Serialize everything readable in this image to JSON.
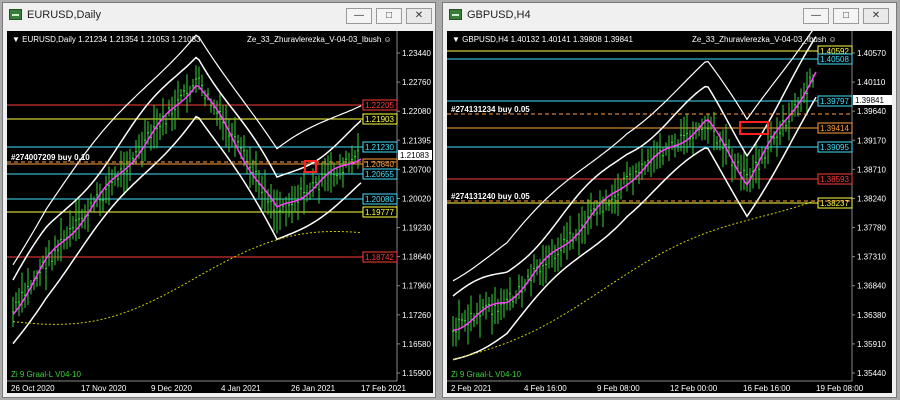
{
  "windows": [
    {
      "id": "left",
      "title": "EURUSD,Daily",
      "header": "▼ EURUSD,Daily  1.21234 1.21354 1.21053 1.21083",
      "indicator": "Ze_33_Zhuravlerezka_V-04-03_Ibush",
      "order_label": "#274007209 buy 0.10",
      "footer_label": "Zi 9 Graal-L V04-10",
      "current_price": "1.21083",
      "price_axis": [
        "1.23440",
        "1.22760",
        "1.22080",
        "1.21395",
        "1.20700",
        "1.20020",
        "1.19230",
        "1.18640",
        "1.17960",
        "1.17260",
        "1.16580",
        "1.15900"
      ],
      "time_axis": [
        "26 Oct 2020",
        "17 Nov 2020",
        "9 Dec 2020",
        "4 Jan 2021",
        "26 Jan 2021",
        "17 Feb 2021"
      ],
      "levels": [
        {
          "label": "1.22205",
          "color": "#ff3b3b"
        },
        {
          "label": "1.21903",
          "color": "#ffff40"
        },
        {
          "label": "1.21230",
          "color": "#40e0ff"
        },
        {
          "label": "1.20840",
          "color": "#ffa040"
        },
        {
          "label": "1.20655",
          "color": "#40e0ff"
        },
        {
          "label": "1.20080",
          "color": "#40e0ff"
        },
        {
          "label": "1.19777",
          "color": "#ffff40"
        },
        {
          "label": "1.18742",
          "color": "#ff3b3b"
        }
      ]
    },
    {
      "id": "right",
      "title": "GBPUSD,H4",
      "header": "▼ GBPUSD,H4  1.40132 1.40141 1.39808 1.39841",
      "indicator": "Ze_33_Zhuravlerezka_V-04-03_Ibush",
      "order_label_1": "#274131234 buy 0.05",
      "order_label_2": "#274131240 buy 0.05",
      "footer_label": "Zi 9 Graal-L V04-10",
      "current_price": "1.39841",
      "price_axis": [
        "1.40570",
        "1.40110",
        "1.39640",
        "1.39170",
        "1.38710",
        "1.38240",
        "1.37780",
        "1.37310",
        "1.36840",
        "1.36380",
        "1.35910",
        "1.35440"
      ],
      "time_axis": [
        "2 Feb 2021",
        "4 Feb 16:00",
        "9 Feb 08:00",
        "12 Feb 00:00",
        "16 Feb 16:00",
        "19 Feb 08:00"
      ],
      "levels": [
        {
          "label": "1.40592",
          "color": "#ffff40"
        },
        {
          "label": "1.40508",
          "color": "#40e0ff"
        },
        {
          "label": "1.39797",
          "color": "#40e0ff"
        },
        {
          "label": "1.39414",
          "color": "#ffa040"
        },
        {
          "label": "1.39095",
          "color": "#40e0ff"
        },
        {
          "label": "1.38593",
          "color": "#ff3b3b"
        },
        {
          "label": "1.38237",
          "color": "#ffff40"
        }
      ]
    }
  ],
  "window_buttons": {
    "minimize": "—",
    "maximize": "□",
    "close": "✕"
  },
  "colors": {
    "background": "#000000",
    "grid": "#888888",
    "bull": "#37d537",
    "ma_pink": "#ff40ff",
    "band": "#ffffff",
    "dotted": "#d0d000"
  }
}
